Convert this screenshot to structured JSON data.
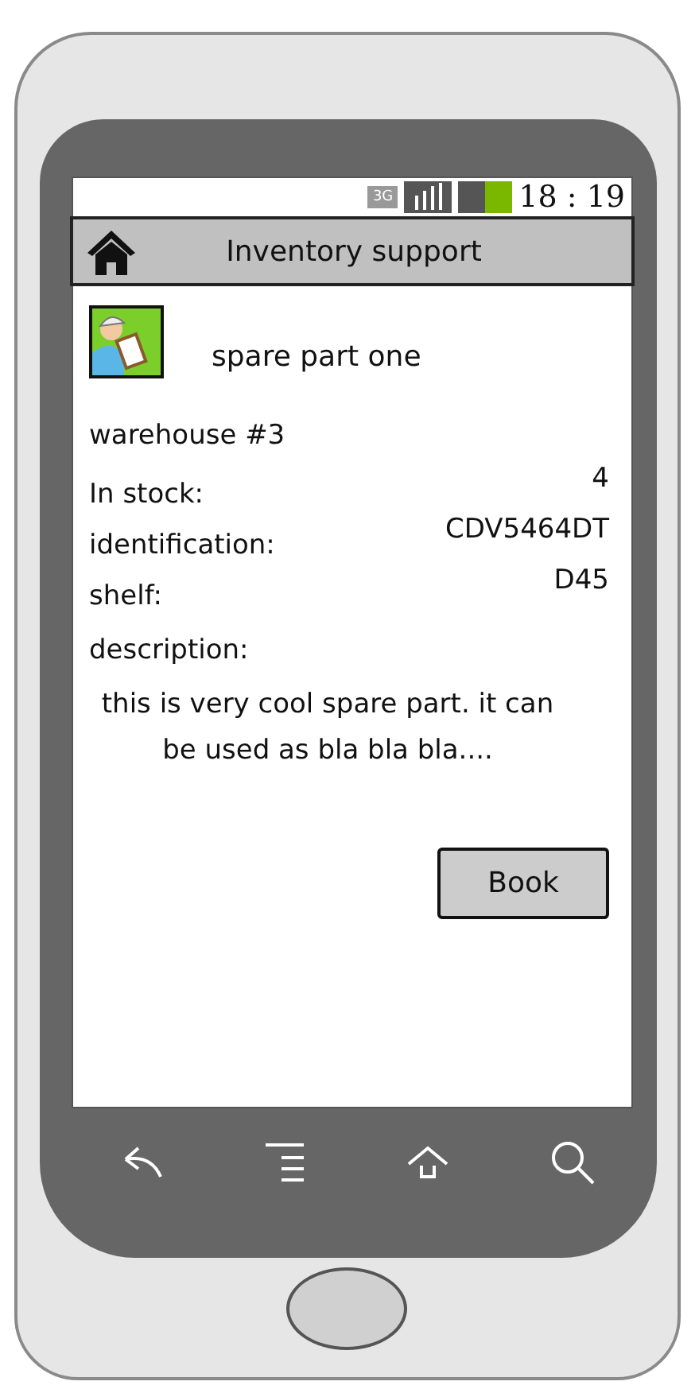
{
  "status_bar": {
    "network": "3G",
    "time": "18 : 19"
  },
  "title_bar": {
    "title": "Inventory support"
  },
  "item": {
    "name": "spare part one"
  },
  "warehouse": "warehouse #3",
  "fields": [
    {
      "label": "In stock:",
      "value": "4"
    },
    {
      "label": "identification:",
      "value": "CDV5464DT"
    },
    {
      "label": "shelf:",
      "value": "D45"
    }
  ],
  "description": {
    "label": "description:",
    "text": "this is very cool spare part. it can be used as bla bla bla...."
  },
  "buttons": [
    "Book"
  ]
}
